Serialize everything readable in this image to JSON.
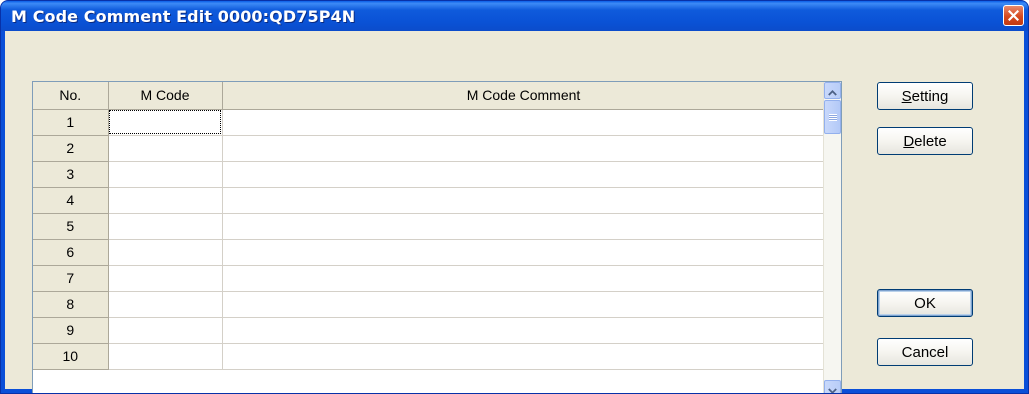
{
  "window": {
    "title": "M Code Comment Edit 0000:QD75P4N"
  },
  "grid": {
    "headers": {
      "no": "No.",
      "mcode": "M Code",
      "comment": "M Code Comment"
    },
    "rows": [
      {
        "no": "1",
        "mcode": "",
        "comment": ""
      },
      {
        "no": "2",
        "mcode": "",
        "comment": ""
      },
      {
        "no": "3",
        "mcode": "",
        "comment": ""
      },
      {
        "no": "4",
        "mcode": "",
        "comment": ""
      },
      {
        "no": "5",
        "mcode": "",
        "comment": ""
      },
      {
        "no": "6",
        "mcode": "",
        "comment": ""
      },
      {
        "no": "7",
        "mcode": "",
        "comment": ""
      },
      {
        "no": "8",
        "mcode": "",
        "comment": ""
      },
      {
        "no": "9",
        "mcode": "",
        "comment": ""
      },
      {
        "no": "10",
        "mcode": "",
        "comment": ""
      }
    ]
  },
  "buttons": {
    "setting": {
      "accel": "S",
      "rest": "etting"
    },
    "delete": {
      "accel": "D",
      "rest": "elete"
    },
    "ok": "OK",
    "cancel": "Cancel"
  },
  "colors": {
    "titlebar": "#0a52d6",
    "client": "#ece9d8",
    "close_button": "#d6491f"
  },
  "icons": {
    "close": "close-x-icon",
    "scroll_up": "chevron-up-icon",
    "scroll_down": "chevron-down-icon"
  }
}
